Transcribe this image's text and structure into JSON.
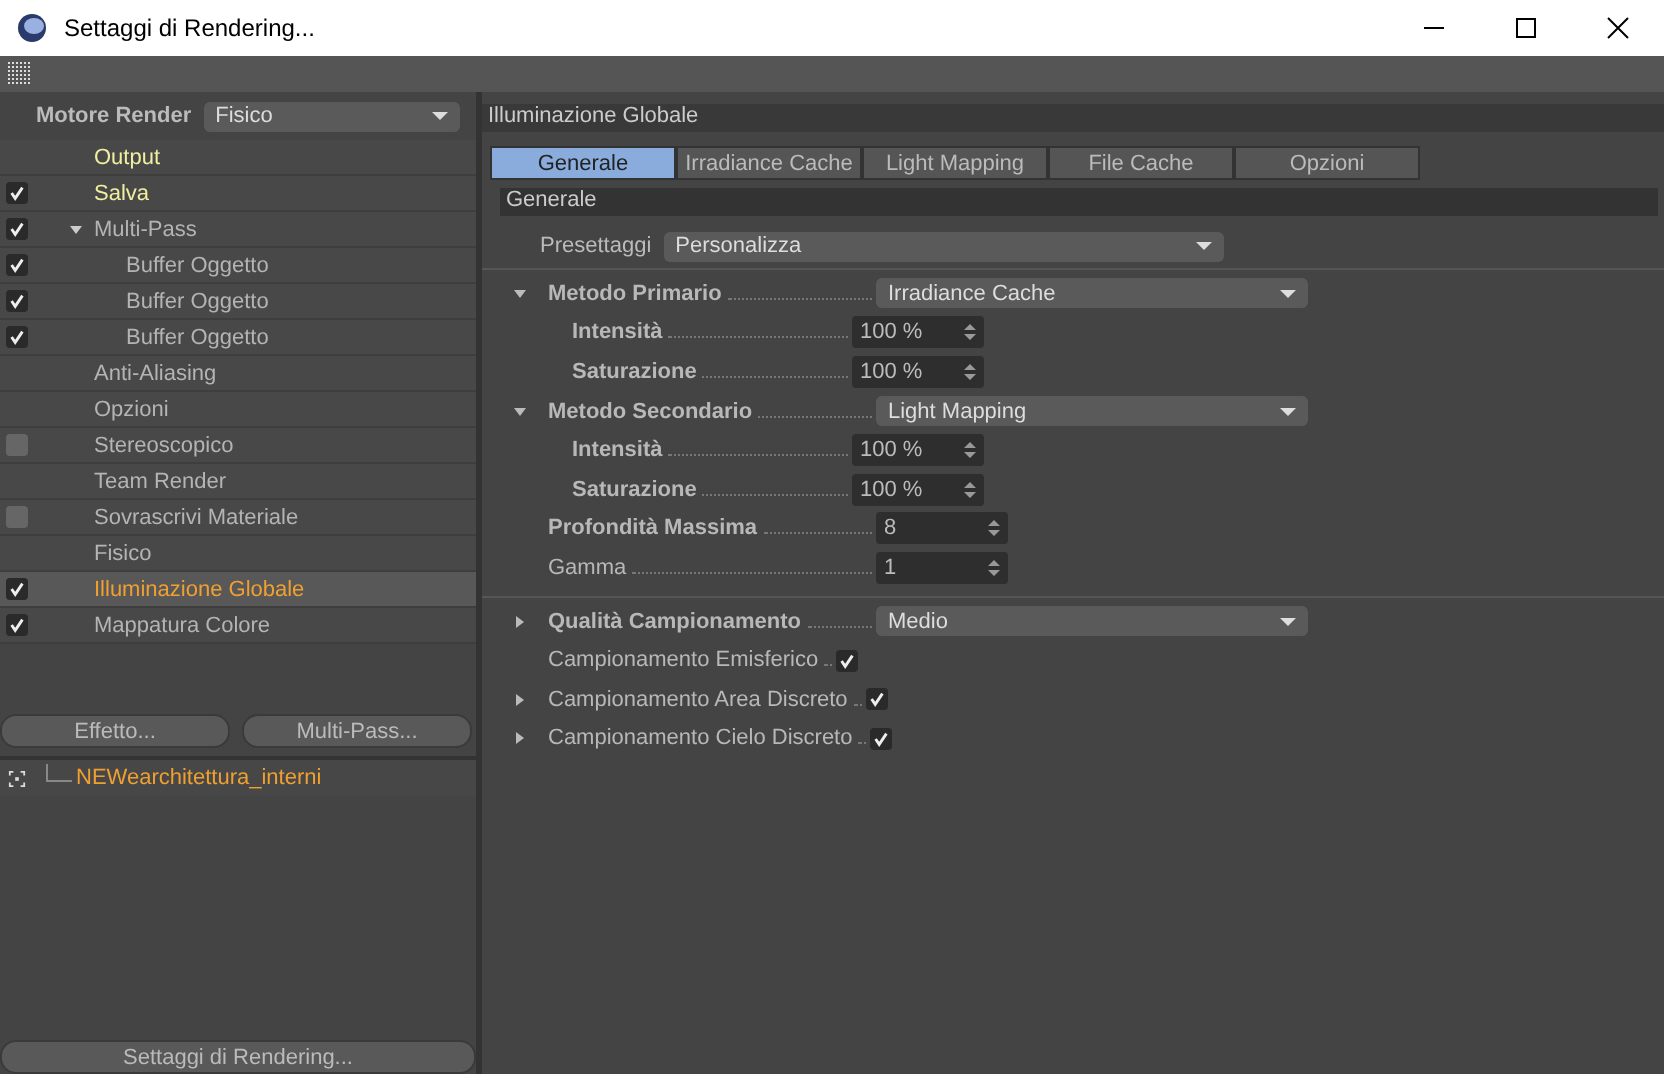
{
  "window": {
    "title": "Settaggi di Rendering..."
  },
  "render_engine": {
    "label": "Motore Render",
    "value": "Fisico"
  },
  "tree": [
    {
      "label": "Output",
      "kind": "plain",
      "color": "#f0f0a0",
      "selected": false
    },
    {
      "label": "Salva",
      "kind": "checkbox",
      "checked": true,
      "color": "#f0f0a0",
      "selected": false
    },
    {
      "label": "Multi-Pass",
      "kind": "checkbox",
      "checked": true,
      "color": "#b4b4b4",
      "selected": false,
      "expanded": true,
      "children": [
        {
          "label": "Buffer Oggetto",
          "kind": "checkbox",
          "checked": true,
          "color": "#b4b4b4",
          "selected": false
        },
        {
          "label": "Buffer Oggetto",
          "kind": "checkbox",
          "checked": true,
          "color": "#b4b4b4",
          "selected": false
        },
        {
          "label": "Buffer Oggetto",
          "kind": "checkbox",
          "checked": true,
          "color": "#b4b4b4",
          "selected": false
        }
      ]
    },
    {
      "label": "Anti-Aliasing",
      "kind": "plain",
      "color": "#b4b4b4",
      "selected": false
    },
    {
      "label": "Opzioni",
      "kind": "plain",
      "color": "#b4b4b4",
      "selected": false
    },
    {
      "label": "Stereoscopico",
      "kind": "checkbox",
      "checked": false,
      "color": "#b4b4b4",
      "selected": false
    },
    {
      "label": "Team Render",
      "kind": "plain",
      "color": "#b4b4b4",
      "selected": false
    },
    {
      "label": "Sovrascrivi Materiale",
      "kind": "checkbox",
      "checked": false,
      "color": "#b4b4b4",
      "selected": false
    },
    {
      "label": "Fisico",
      "kind": "plain",
      "color": "#b4b4b4",
      "selected": false
    },
    {
      "label": "Illuminazione Globale",
      "kind": "checkbox",
      "checked": true,
      "color": "#f0a030",
      "selected": true
    },
    {
      "label": "Mappatura Colore",
      "kind": "checkbox",
      "checked": true,
      "color": "#b4b4b4",
      "selected": false
    }
  ],
  "left_buttons": [
    "Effetto...",
    "Multi-Pass..."
  ],
  "presets": [
    {
      "label": "NEWearchitettura_interni"
    }
  ],
  "bottom_button": "Settaggi di Rendering...",
  "panel": {
    "title": "Illuminazione Globale",
    "tabs": [
      {
        "label": "Generale",
        "selected": true
      },
      {
        "label": "Irradiance Cache",
        "selected": false
      },
      {
        "label": "Light Mapping",
        "selected": false
      },
      {
        "label": "File Cache",
        "selected": false
      },
      {
        "label": "Opzioni",
        "selected": false
      }
    ],
    "section": "Generale",
    "preset": {
      "label": "Presettaggi",
      "value": "Personalizza"
    },
    "groups": [
      [
        {
          "label": "Metodo Primario",
          "kind": "dropdown",
          "value": "Irradiance Cache",
          "bold": true,
          "expanded": true,
          "children": [
            {
              "label": "Intensità",
              "kind": "spinner",
              "value": "100 %",
              "bold": true
            },
            {
              "label": "Saturazione",
              "kind": "spinner",
              "value": "100 %",
              "bold": true
            }
          ]
        },
        {
          "label": "Metodo Secondario",
          "kind": "dropdown",
          "value": "Light Mapping",
          "bold": true,
          "expanded": true,
          "children": [
            {
              "label": "Intensità",
              "kind": "spinner",
              "value": "100 %",
              "bold": true
            },
            {
              "label": "Saturazione",
              "kind": "spinner",
              "value": "100 %",
              "bold": true
            }
          ]
        },
        {
          "label": "Profondità Massima",
          "kind": "spinner",
          "value": "8",
          "bold": true
        },
        {
          "label": "Gamma",
          "kind": "spinner",
          "value": "1",
          "bold": false
        }
      ],
      [
        {
          "label": "Qualità Campionamento",
          "kind": "dropdown",
          "value": "Medio",
          "bold": true,
          "expanded": false
        },
        {
          "label": "Campionamento Emisferico",
          "kind": "checkbox",
          "checked": true,
          "bold": false
        },
        {
          "label": "Campionamento Area Discreto",
          "kind": "checkbox",
          "checked": true,
          "bold": false,
          "expanded": false
        },
        {
          "label": "Campionamento Cielo Discreto",
          "kind": "checkbox",
          "checked": true,
          "bold": false,
          "expanded": false
        }
      ]
    ]
  }
}
